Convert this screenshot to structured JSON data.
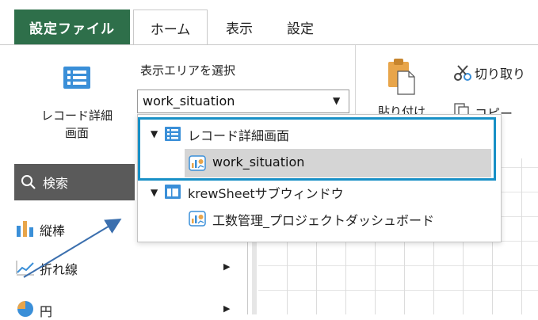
{
  "tabs": {
    "file": "設定ファイル",
    "home": "ホーム",
    "view": "表示",
    "settings": "設定"
  },
  "ribbon": {
    "record_detail_label": "レコード詳細\n画面",
    "area_label": "表示エリアを選択",
    "area_select_value": "work_situation",
    "paste_label": "貼り付け",
    "cut_label": "切り取り",
    "copy_label": "コピー"
  },
  "sidebar": {
    "search_label": "検索",
    "items": [
      {
        "label": "縦棒"
      },
      {
        "label": "折れ線"
      },
      {
        "label": "円"
      }
    ]
  },
  "dropdown": {
    "items": [
      {
        "label": "レコード詳細画面",
        "level": 0,
        "expanded": true
      },
      {
        "label": "work_situation",
        "level": 1,
        "selected": true
      },
      {
        "label": "krewSheetサブウィンドウ",
        "level": 0,
        "expanded": true
      },
      {
        "label": "工数管理_プロジェクトダッシュボード",
        "level": 1
      }
    ]
  },
  "colors": {
    "file_tab": "#2e6f4a",
    "highlight": "#1890c6",
    "accent_blue": "#3a8fd8",
    "search_bg": "#5a5a5a",
    "arrow": "#3b6fae"
  }
}
